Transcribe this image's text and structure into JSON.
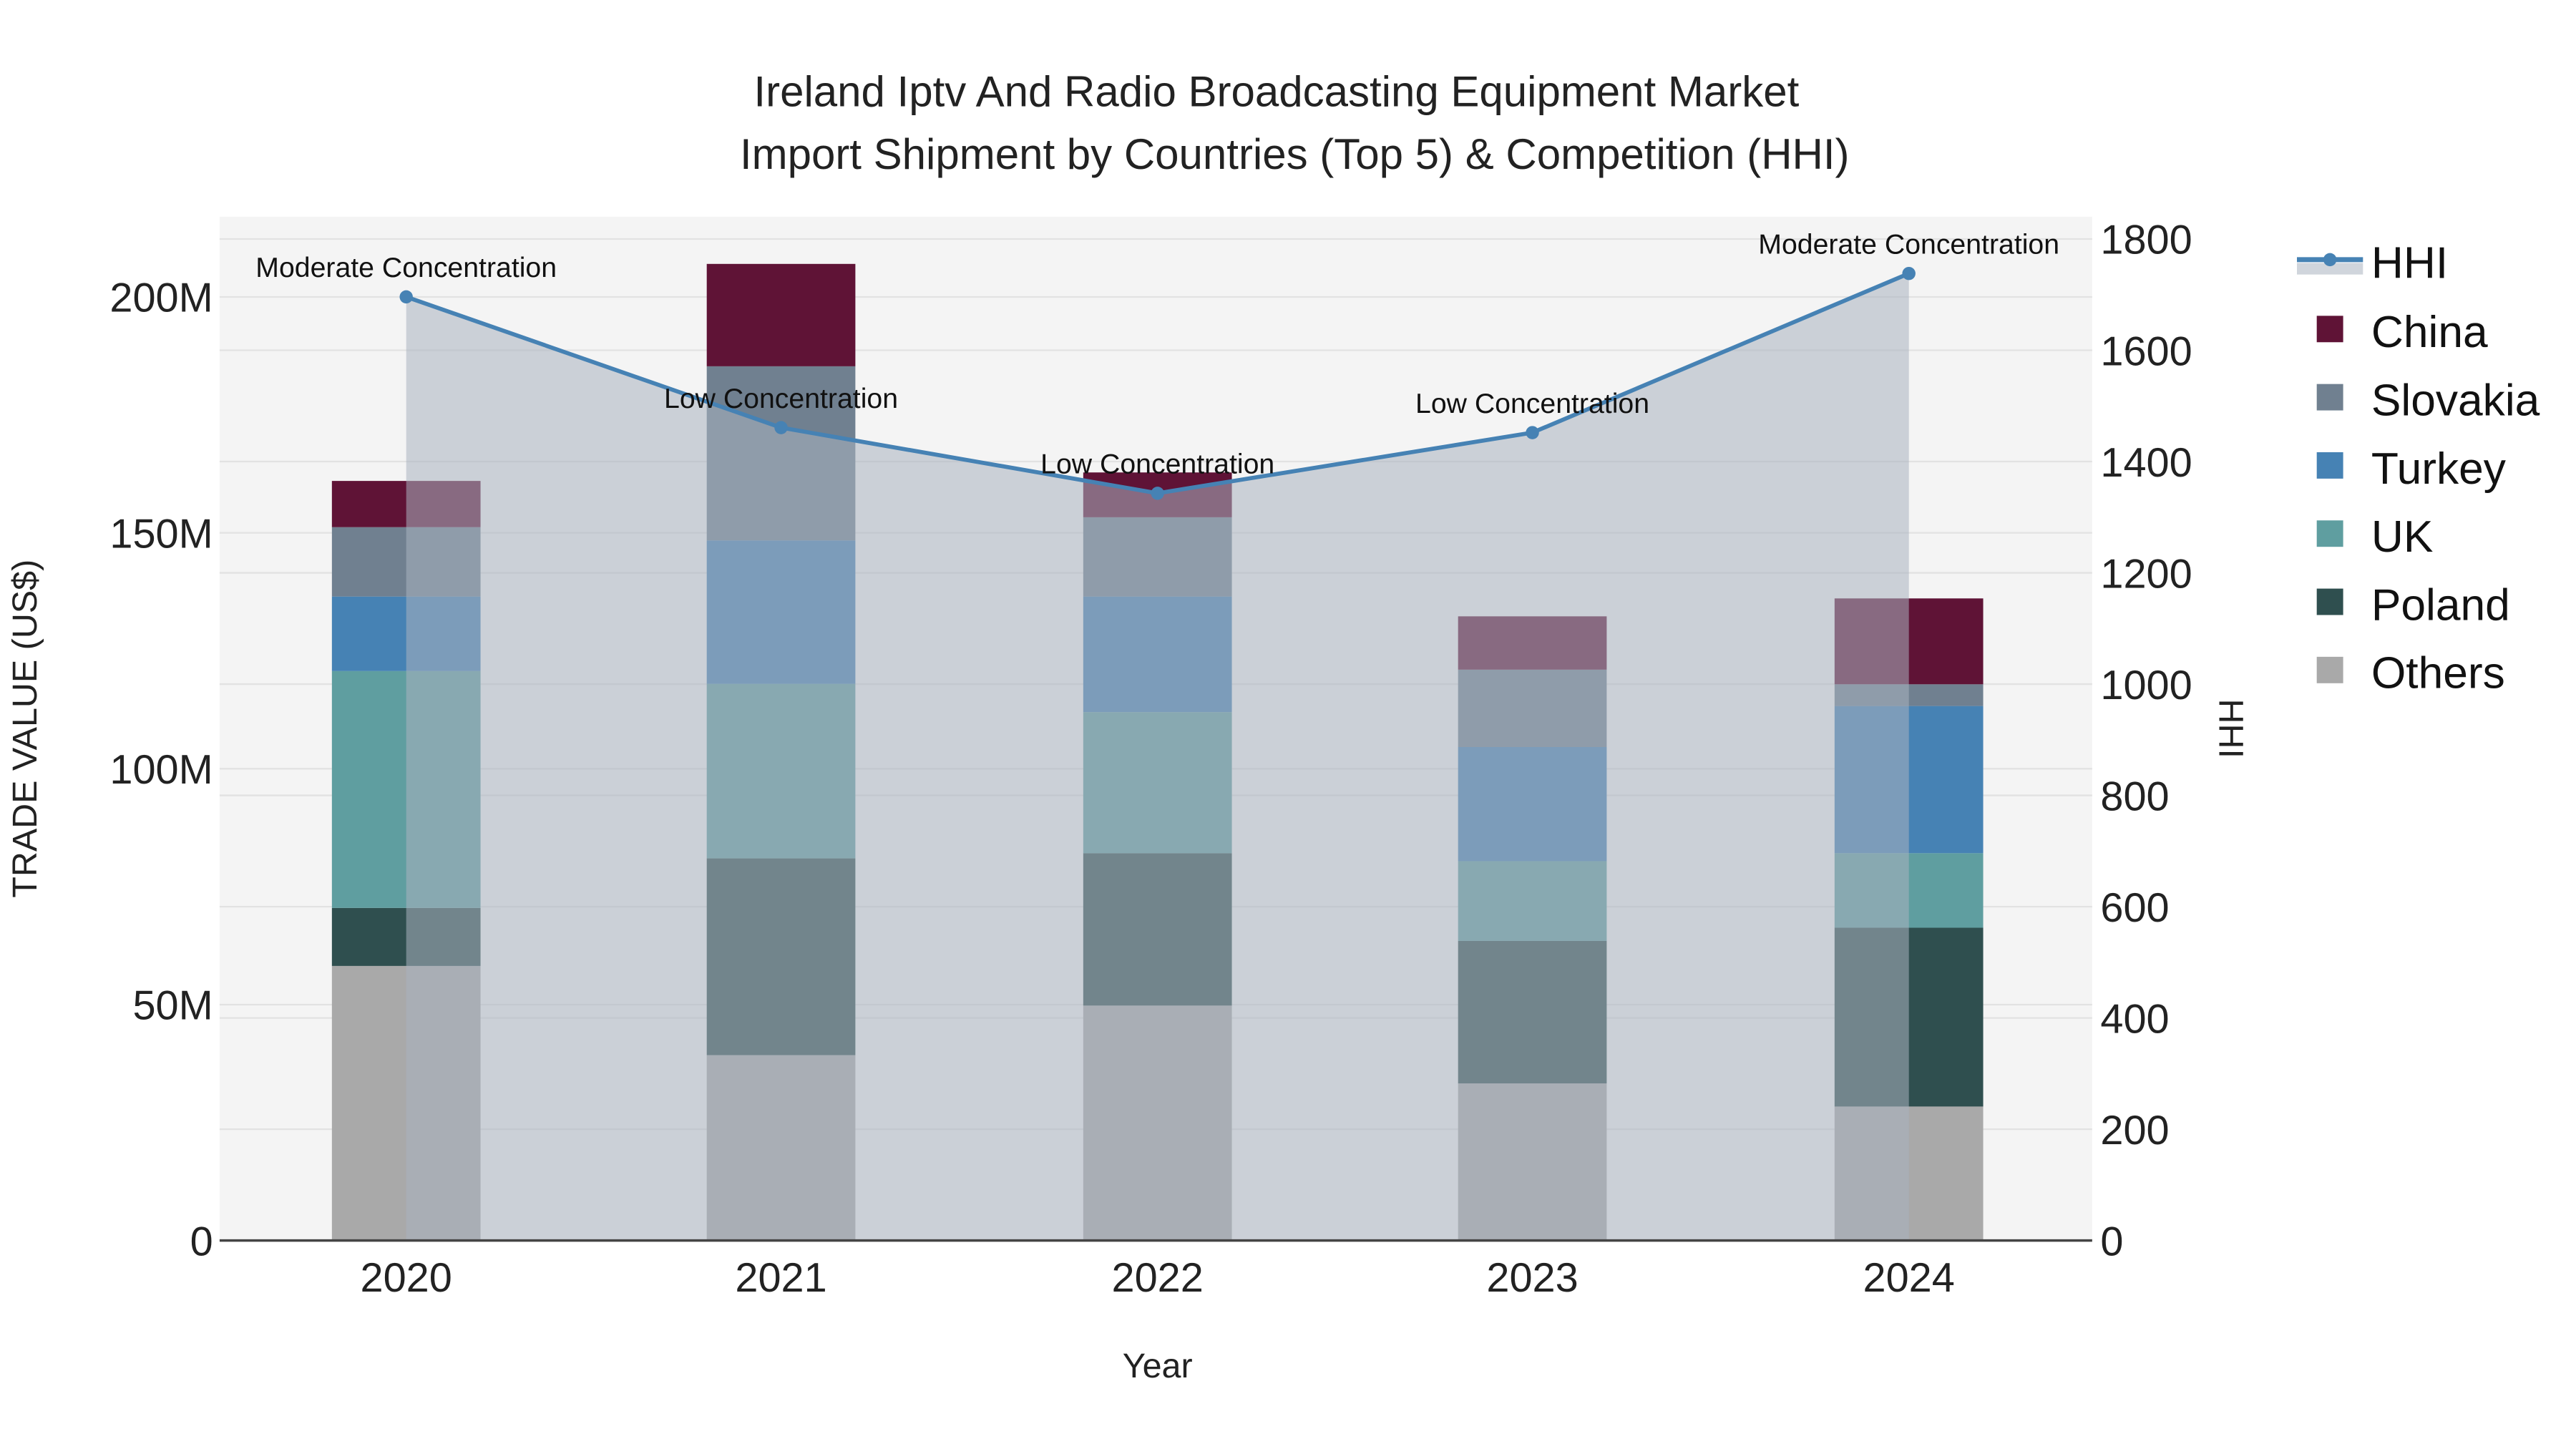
{
  "chart_data": {
    "type": "bar",
    "title_line1": "Ireland Iptv And Radio Broadcasting Equipment Market",
    "title_line2": "Import Shipment by Countries (Top 5) & Competition (HHI)",
    "xlabel": "Year",
    "ylabel": "TRADE VALUE (US$)",
    "y2label": "HHI",
    "categories": [
      "2020",
      "2021",
      "2022",
      "2023",
      "2024"
    ],
    "ylim": [
      0,
      217
    ],
    "y2lim": [
      0,
      1840
    ],
    "yticks": [
      {
        "v": 0,
        "label": "0"
      },
      {
        "v": 50,
        "label": "50M"
      },
      {
        "v": 100,
        "label": "100M"
      },
      {
        "v": 150,
        "label": "150M"
      },
      {
        "v": 200,
        "label": "200M"
      }
    ],
    "y2ticks": [
      {
        "v": 0,
        "label": "0"
      },
      {
        "v": 200,
        "label": "200"
      },
      {
        "v": 400,
        "label": "400"
      },
      {
        "v": 600,
        "label": "600"
      },
      {
        "v": 800,
        "label": "800"
      },
      {
        "v": 1000,
        "label": "1000"
      },
      {
        "v": 1200,
        "label": "1200"
      },
      {
        "v": 1400,
        "label": "1400"
      },
      {
        "v": 1600,
        "label": "1600"
      },
      {
        "v": 1800,
        "label": "1800"
      }
    ],
    "units": "US$ millions",
    "series": [
      {
        "name": "Others",
        "color": "#a9a9a9",
        "values": [
          58.2,
          39.3,
          49.8,
          33.3,
          28.4
        ]
      },
      {
        "name": "Poland",
        "color": "#2f4f4f",
        "values": [
          12.3,
          41.7,
          32.3,
          30.2,
          37.9
        ]
      },
      {
        "name": "UK",
        "color": "#5f9ea0",
        "values": [
          50.2,
          37.0,
          29.9,
          16.9,
          15.8
        ]
      },
      {
        "name": "Turkey",
        "color": "#4682b4",
        "values": [
          15.8,
          30.4,
          24.5,
          24.2,
          31.2
        ]
      },
      {
        "name": "Slovakia",
        "color": "#708090",
        "values": [
          14.7,
          36.9,
          16.8,
          16.4,
          4.6
        ]
      },
      {
        "name": "China",
        "color": "#5f1336",
        "values": [
          9.8,
          21.7,
          9.5,
          11.3,
          18.2
        ]
      }
    ],
    "hhi": {
      "name": "HHI",
      "color": "#4682b4",
      "values": [
        1696,
        1461,
        1343,
        1452,
        1738
      ],
      "annotations": [
        "Moderate Concentration",
        "Low Concentration",
        "Low Concentration",
        "Low Concentration",
        "Moderate Concentration"
      ]
    },
    "legend": [
      "HHI",
      "China",
      "Slovakia",
      "Turkey",
      "UK",
      "Poland",
      "Others"
    ],
    "legend_placement": "right",
    "grid": true
  }
}
